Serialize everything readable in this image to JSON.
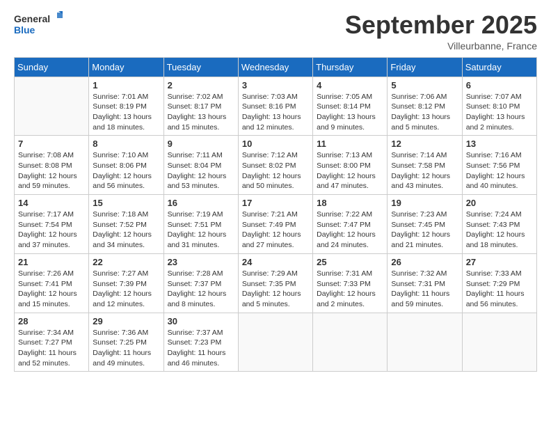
{
  "logo": {
    "line1": "General",
    "line2": "Blue"
  },
  "title": "September 2025",
  "location": "Villeurbanne, France",
  "days_of_week": [
    "Sunday",
    "Monday",
    "Tuesday",
    "Wednesday",
    "Thursday",
    "Friday",
    "Saturday"
  ],
  "weeks": [
    [
      {
        "day": "",
        "info": ""
      },
      {
        "day": "1",
        "info": "Sunrise: 7:01 AM\nSunset: 8:19 PM\nDaylight: 13 hours\nand 18 minutes."
      },
      {
        "day": "2",
        "info": "Sunrise: 7:02 AM\nSunset: 8:17 PM\nDaylight: 13 hours\nand 15 minutes."
      },
      {
        "day": "3",
        "info": "Sunrise: 7:03 AM\nSunset: 8:16 PM\nDaylight: 13 hours\nand 12 minutes."
      },
      {
        "day": "4",
        "info": "Sunrise: 7:05 AM\nSunset: 8:14 PM\nDaylight: 13 hours\nand 9 minutes."
      },
      {
        "day": "5",
        "info": "Sunrise: 7:06 AM\nSunset: 8:12 PM\nDaylight: 13 hours\nand 5 minutes."
      },
      {
        "day": "6",
        "info": "Sunrise: 7:07 AM\nSunset: 8:10 PM\nDaylight: 13 hours\nand 2 minutes."
      }
    ],
    [
      {
        "day": "7",
        "info": "Sunrise: 7:08 AM\nSunset: 8:08 PM\nDaylight: 12 hours\nand 59 minutes."
      },
      {
        "day": "8",
        "info": "Sunrise: 7:10 AM\nSunset: 8:06 PM\nDaylight: 12 hours\nand 56 minutes."
      },
      {
        "day": "9",
        "info": "Sunrise: 7:11 AM\nSunset: 8:04 PM\nDaylight: 12 hours\nand 53 minutes."
      },
      {
        "day": "10",
        "info": "Sunrise: 7:12 AM\nSunset: 8:02 PM\nDaylight: 12 hours\nand 50 minutes."
      },
      {
        "day": "11",
        "info": "Sunrise: 7:13 AM\nSunset: 8:00 PM\nDaylight: 12 hours\nand 47 minutes."
      },
      {
        "day": "12",
        "info": "Sunrise: 7:14 AM\nSunset: 7:58 PM\nDaylight: 12 hours\nand 43 minutes."
      },
      {
        "day": "13",
        "info": "Sunrise: 7:16 AM\nSunset: 7:56 PM\nDaylight: 12 hours\nand 40 minutes."
      }
    ],
    [
      {
        "day": "14",
        "info": "Sunrise: 7:17 AM\nSunset: 7:54 PM\nDaylight: 12 hours\nand 37 minutes."
      },
      {
        "day": "15",
        "info": "Sunrise: 7:18 AM\nSunset: 7:52 PM\nDaylight: 12 hours\nand 34 minutes."
      },
      {
        "day": "16",
        "info": "Sunrise: 7:19 AM\nSunset: 7:51 PM\nDaylight: 12 hours\nand 31 minutes."
      },
      {
        "day": "17",
        "info": "Sunrise: 7:21 AM\nSunset: 7:49 PM\nDaylight: 12 hours\nand 27 minutes."
      },
      {
        "day": "18",
        "info": "Sunrise: 7:22 AM\nSunset: 7:47 PM\nDaylight: 12 hours\nand 24 minutes."
      },
      {
        "day": "19",
        "info": "Sunrise: 7:23 AM\nSunset: 7:45 PM\nDaylight: 12 hours\nand 21 minutes."
      },
      {
        "day": "20",
        "info": "Sunrise: 7:24 AM\nSunset: 7:43 PM\nDaylight: 12 hours\nand 18 minutes."
      }
    ],
    [
      {
        "day": "21",
        "info": "Sunrise: 7:26 AM\nSunset: 7:41 PM\nDaylight: 12 hours\nand 15 minutes."
      },
      {
        "day": "22",
        "info": "Sunrise: 7:27 AM\nSunset: 7:39 PM\nDaylight: 12 hours\nand 12 minutes."
      },
      {
        "day": "23",
        "info": "Sunrise: 7:28 AM\nSunset: 7:37 PM\nDaylight: 12 hours\nand 8 minutes."
      },
      {
        "day": "24",
        "info": "Sunrise: 7:29 AM\nSunset: 7:35 PM\nDaylight: 12 hours\nand 5 minutes."
      },
      {
        "day": "25",
        "info": "Sunrise: 7:31 AM\nSunset: 7:33 PM\nDaylight: 12 hours\nand 2 minutes."
      },
      {
        "day": "26",
        "info": "Sunrise: 7:32 AM\nSunset: 7:31 PM\nDaylight: 11 hours\nand 59 minutes."
      },
      {
        "day": "27",
        "info": "Sunrise: 7:33 AM\nSunset: 7:29 PM\nDaylight: 11 hours\nand 56 minutes."
      }
    ],
    [
      {
        "day": "28",
        "info": "Sunrise: 7:34 AM\nSunset: 7:27 PM\nDaylight: 11 hours\nand 52 minutes."
      },
      {
        "day": "29",
        "info": "Sunrise: 7:36 AM\nSunset: 7:25 PM\nDaylight: 11 hours\nand 49 minutes."
      },
      {
        "day": "30",
        "info": "Sunrise: 7:37 AM\nSunset: 7:23 PM\nDaylight: 11 hours\nand 46 minutes."
      },
      {
        "day": "",
        "info": ""
      },
      {
        "day": "",
        "info": ""
      },
      {
        "day": "",
        "info": ""
      },
      {
        "day": "",
        "info": ""
      }
    ]
  ]
}
